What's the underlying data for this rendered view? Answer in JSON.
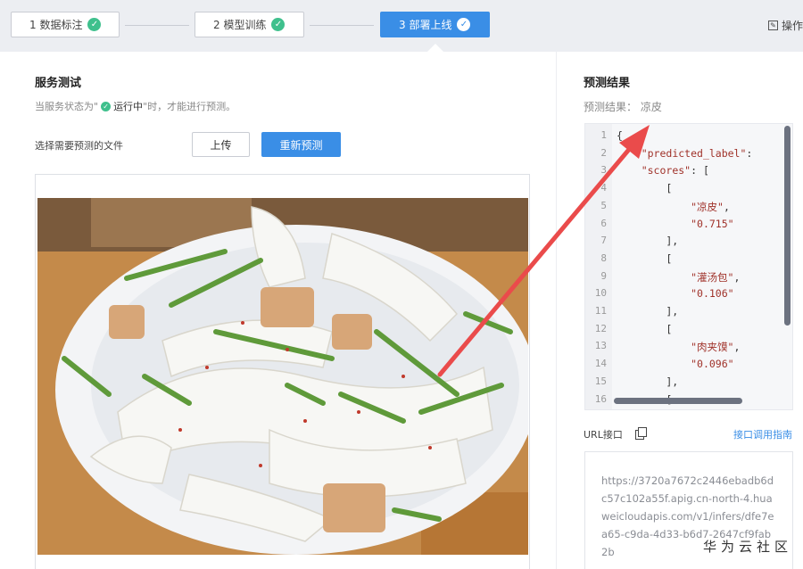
{
  "steps": [
    {
      "label": "1 数据标注"
    },
    {
      "label": "2 模型训练"
    },
    {
      "label": "3 部署上线"
    }
  ],
  "header": {
    "op_log": "操作"
  },
  "service_test": {
    "title": "服务测试",
    "hint_prefix": "当服务状态为\"",
    "hint_status": "运行中",
    "hint_suffix": "\"时，才能进行预测。",
    "choose_label": "选择需要预测的文件",
    "upload_label": "上传",
    "repredict_label": "重新预测"
  },
  "prediction": {
    "title": "预测结果",
    "result_text": "预测结果：  凉皮",
    "code_line_numbers": [
      "1",
      "2",
      "3",
      "4",
      "5",
      "6",
      "7",
      "8",
      "9",
      "10",
      "11",
      "12",
      "13",
      "14",
      "15",
      "16"
    ],
    "code_lines": [
      "{",
      "    \"predicted_label\": ",
      "    \"scores\": [",
      "        [",
      "            \"凉皮\",",
      "            \"0.715\"",
      "        ],",
      "        [",
      "            \"灌汤包\",",
      "            \"0.106\"",
      "        ],",
      "        [",
      "            \"肉夹馍\",",
      "            \"0.096\"",
      "        ],",
      "        ["
    ]
  },
  "url": {
    "label": "URL接口",
    "guide_label": "接口调用指南",
    "value": "https://3720a7672c2446ebadb6dc57c102a55f.apig.cn-north-4.huaweicloudapis.com/v1/infers/dfe7ea65-c9da-4d33-b6d7-2647cf9fab2b"
  },
  "watermark": "华为云社区",
  "colors": {
    "accent": "#3a8ee6",
    "success": "#3fc08d",
    "arrow": "#ea4b4b"
  }
}
